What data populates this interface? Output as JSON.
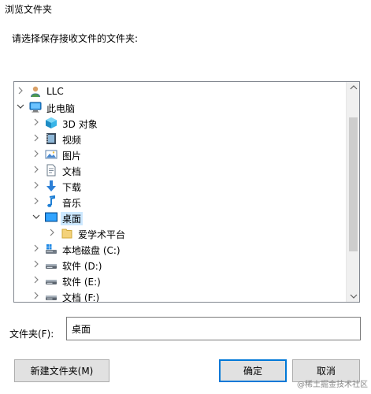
{
  "title": "浏览文件夹",
  "prompt": "请选择保存接收文件的文件夹:",
  "tree": [
    {
      "label": "LLC",
      "icon": "user-icon",
      "expanded": false
    },
    {
      "label": "此电脑",
      "icon": "computer-icon",
      "expanded": true
    },
    {
      "label": "3D 对象",
      "icon": "3d-objects-icon",
      "expanded": false
    },
    {
      "label": "视频",
      "icon": "video-icon",
      "expanded": false
    },
    {
      "label": "图片",
      "icon": "pictures-icon",
      "expanded": false
    },
    {
      "label": "文档",
      "icon": "documents-icon",
      "expanded": false
    },
    {
      "label": "下载",
      "icon": "download-icon",
      "expanded": false
    },
    {
      "label": "音乐",
      "icon": "music-icon",
      "expanded": false
    },
    {
      "label": "桌面",
      "icon": "desktop-icon",
      "expanded": true,
      "selected": true
    },
    {
      "label": "爱学术平台",
      "icon": "folder-icon",
      "expanded": false
    },
    {
      "label": "本地磁盘 (C:)",
      "icon": "os-drive-icon",
      "expanded": false
    },
    {
      "label": "软件 (D:)",
      "icon": "drive-icon",
      "expanded": false
    },
    {
      "label": "软件 (E:)",
      "icon": "drive-icon",
      "expanded": false
    },
    {
      "label": "文档 (F:)",
      "icon": "drive-icon",
      "expanded": false
    }
  ],
  "folder_label": "文件夹(F):",
  "folder_value": "桌面",
  "buttons": {
    "new_folder": "新建文件夹(M)",
    "ok": "确定",
    "cancel": "取消"
  },
  "watermark": "@稀土掘金技术社区",
  "colors": {
    "selection": "#cce8ff",
    "accent": "#0078d7"
  }
}
